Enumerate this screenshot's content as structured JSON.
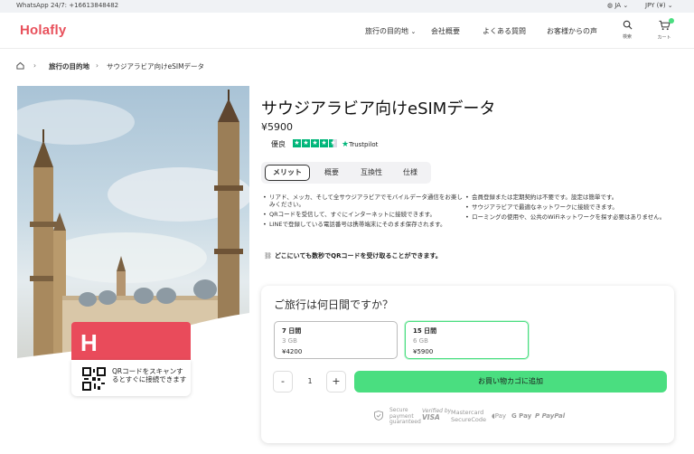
{
  "topbar": {
    "whatsapp": "WhatsApp 24/7: +16613848482",
    "language": "JA",
    "currency": "JPY (¥)"
  },
  "header": {
    "logo": "Holafly",
    "nav": [
      "旅行の目的地",
      "会社概要",
      "よくある質問",
      "お客様からの声"
    ],
    "search_label": "検索",
    "cart_label": "カート"
  },
  "breadcrumb": {
    "destinations": "旅行の目的地",
    "current": "サウジアラビア向けeSIMデータ"
  },
  "hero": {
    "qr_caption": "QRコードをスキャンするとすぐに接続できます"
  },
  "product": {
    "title": "サウジアラビア向けeSIMデータ",
    "price": "¥5900",
    "rating_label": "優良",
    "trustpilot": "Trustpilot",
    "stars": 4.5
  },
  "tabs": [
    "メリット",
    "概要",
    "互換性",
    "仕様"
  ],
  "benefits": {
    "left": [
      "リアド、メッカ、そして全サウジアラビアでモバイルデータ通信をお楽しみください。",
      "QRコードを受信して、すぐにインターネットに接続できます。",
      "LINEで登録している電話番号は携帯端末にそのまま保存されます。"
    ],
    "right": [
      "会員登録または定期契約は不要です。設定は簡単です。",
      "サウジアラビアで最適なネットワークに接続できます。",
      "ローミングの使用や、公共のWiFiネットワークを探す必要はありません。"
    ],
    "qr_note": "どこにいても数秒でQRコードを受け取ることができます。"
  },
  "purchase": {
    "question": "ご旅行は何日間ですか？",
    "plans": [
      {
        "days": "7 日間",
        "data": "3 GB",
        "price": "¥4200",
        "selected": false
      },
      {
        "days": "15 日間",
        "data": "6 GB",
        "price": "¥5900",
        "selected": true
      }
    ],
    "minus": "-",
    "quantity": "1",
    "plus": "+",
    "add_to_cart": "お買い物カゴに追加",
    "accent_color": "#4ade80"
  },
  "trust": {
    "secure": [
      "Secure",
      "payment",
      "guaranteed"
    ],
    "visa": [
      "Verified by",
      "VISA"
    ],
    "mastercard": [
      "Mastercard",
      "SecureCode"
    ],
    "apple_pay": "Pay",
    "google_pay": "G Pay",
    "paypal": "PayPal"
  }
}
